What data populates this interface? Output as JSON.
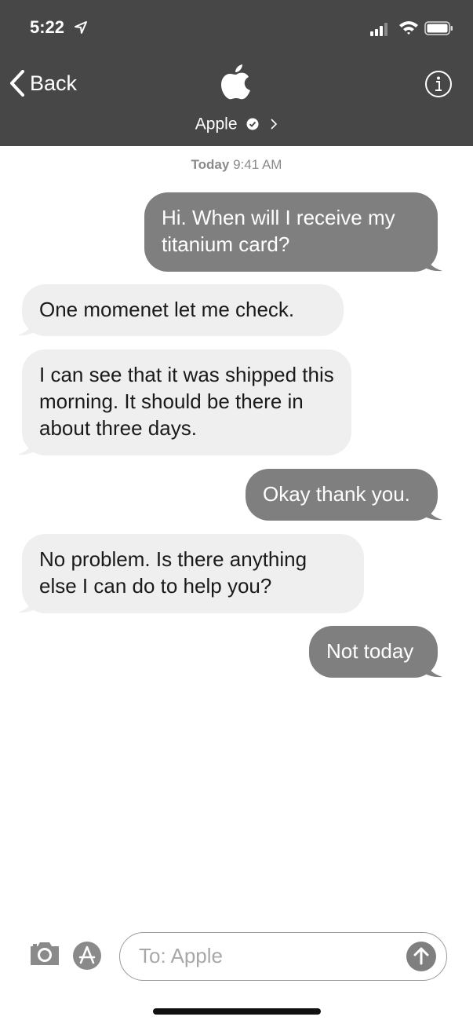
{
  "status_bar": {
    "time": "5:22"
  },
  "nav": {
    "back_label": "Back",
    "contact_name": "Apple"
  },
  "thread": {
    "timestamp_day": "Today",
    "timestamp_time": "9:41 AM",
    "messages": [
      {
        "direction": "outgoing",
        "text": "Hi. When will I receive my titanium card?"
      },
      {
        "direction": "incoming",
        "text": "One momenet let me check."
      },
      {
        "direction": "incoming",
        "text": "I can see that it was shipped this morning. It should be there in about three days."
      },
      {
        "direction": "outgoing",
        "text": "Okay thank you."
      },
      {
        "direction": "incoming",
        "text": "No problem. Is there anything else I can do to help you?"
      },
      {
        "direction": "outgoing",
        "text": "Not today"
      }
    ]
  },
  "composer": {
    "placeholder": "To: Apple"
  },
  "colors": {
    "header_bg": "#474747",
    "outgoing_bubble": "#7f7f7f",
    "incoming_bubble": "#efefef"
  }
}
